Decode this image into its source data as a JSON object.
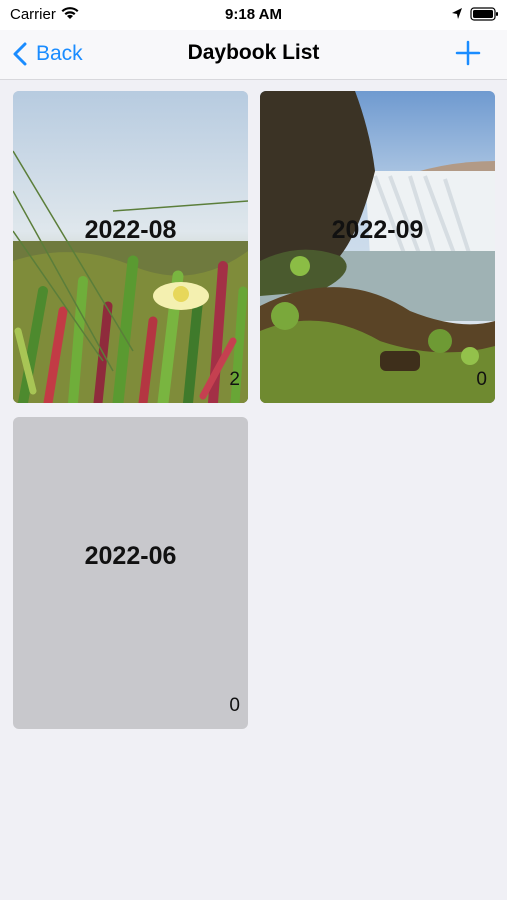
{
  "status_bar": {
    "carrier": "Carrier",
    "time": "9:18 AM"
  },
  "nav": {
    "back_label": "Back",
    "title": "Daybook List",
    "add_icon": "plus-icon"
  },
  "colors": {
    "accent": "#1a8cff",
    "background": "#f0f0f5",
    "empty_card": "#c8c8cc"
  },
  "daybooks": [
    {
      "title": "2022-08",
      "count": "2",
      "image": "flower-photo"
    },
    {
      "title": "2022-09",
      "count": "0",
      "image": "waterfall-photo"
    },
    {
      "title": "2022-06",
      "count": "0",
      "image": "none"
    }
  ]
}
